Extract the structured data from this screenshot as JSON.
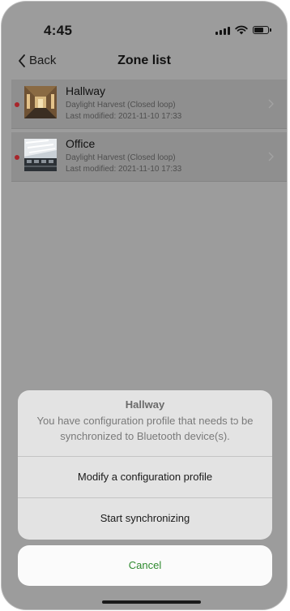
{
  "status_bar": {
    "time": "4:45",
    "icons": [
      "signal-icon",
      "wifi-icon",
      "battery-icon"
    ]
  },
  "nav": {
    "back_label": "Back",
    "title": "Zone list"
  },
  "zones": [
    {
      "name": "Hallway",
      "mode": "Daylight Harvest (Closed loop)",
      "last_modified": "Last modified: 2021-11-10 17:33",
      "has_unsynced_indicator": true,
      "indicator_color": "#a8262b"
    },
    {
      "name": "Office",
      "mode": "Daylight Harvest (Closed loop)",
      "last_modified": "Last modified: 2021-11-10 17:33",
      "has_unsynced_indicator": true,
      "indicator_color": "#a8262b"
    }
  ],
  "action_sheet": {
    "title": "Hallway",
    "message": "You have configuration profile that needs tɔ be synchronized to Bluetooth device(s).",
    "actions": [
      {
        "label": "Modify a configuration profile"
      },
      {
        "label": "Start synchronizing"
      }
    ],
    "cancel_label": "Cancel",
    "cancel_color": "#2f8a2f"
  }
}
